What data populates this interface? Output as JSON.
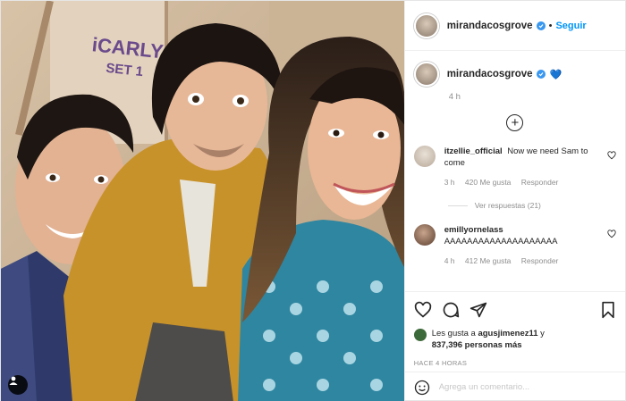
{
  "header": {
    "username": "mirandacosgrove",
    "separator": "•",
    "follow_label": "Seguir"
  },
  "caption": {
    "username": "mirandacosgrove",
    "emoji": "💙",
    "time": "4 h"
  },
  "photo": {
    "sign_text_line1": "iCARLY",
    "sign_text_line2": "SET 1"
  },
  "comments": [
    {
      "username": "itzellie_official",
      "text": "Now we need Sam to come",
      "time": "3 h",
      "likes": "420 Me gusta",
      "reply_label": "Responder",
      "view_replies": "Ver respuestas (21)"
    },
    {
      "username": "emillyornelass",
      "text": "AAAAAAAAAAAAAAAAAAAA",
      "time": "4 h",
      "likes": "412 Me gusta",
      "reply_label": "Responder"
    }
  ],
  "likes": {
    "prefix": "Les gusta a",
    "first_user": "agusjimenez11",
    "joiner": "y",
    "others": "837,396 personas más"
  },
  "timestamp": "HACE 4 HORAS",
  "add_comment": {
    "placeholder": "Agrega un comentario..."
  },
  "colors": {
    "accent": "#0095f6",
    "verified": "#3897f0",
    "muted": "#8e8e8e",
    "text": "#262626"
  },
  "icons": [
    "verified-badge-icon",
    "plus-circle-icon",
    "heart-icon",
    "comment-icon",
    "share-icon",
    "bookmark-icon",
    "smiley-icon",
    "user-tag-icon"
  ]
}
